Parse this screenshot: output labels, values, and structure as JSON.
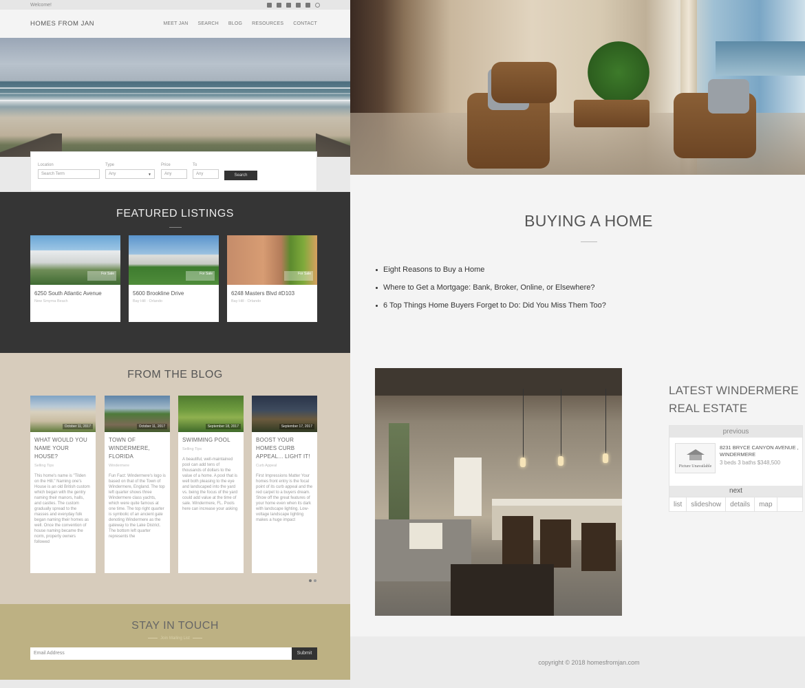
{
  "topbar": {
    "welcome": "Welcome!"
  },
  "nav": {
    "brand": "HOMES FROM JAN",
    "items": [
      "MEET JAN",
      "SEARCH",
      "BLOG",
      "RESOURCES",
      "CONTACT"
    ]
  },
  "search": {
    "location_label": "Location",
    "location_placeholder": "Search Term",
    "type_label": "Type",
    "type_value": "Any",
    "price_label": "Price",
    "price_value": "Any",
    "to_label": "To",
    "to_value": "Any",
    "button": "Search"
  },
  "featured": {
    "title": "FEATURED LISTINGS",
    "listings": [
      {
        "address": "6250 South Atlantic Avenue",
        "city": "New Smyrna Beach",
        "tag": "For Sale"
      },
      {
        "address": "5600 Brookline Drive",
        "city": "Bay Hill  ·  Orlando",
        "tag": "For Sale"
      },
      {
        "address": "6248 Masters Blvd #D103",
        "city": "Bay Hill  ·  Orlando",
        "tag": "For Sale"
      }
    ]
  },
  "blog": {
    "title": "FROM THE BLOG",
    "posts": [
      {
        "title": "WHAT WOULD YOU NAME YOUR HOUSE?",
        "category": "Selling Tips",
        "date": "October 11, 2017",
        "excerpt": "This home's name is \"Tilden on the Hill.\" Naming one's House is an old British custom which began with the gentry naming their manors, halls, and castles. The custom gradually spread to the masses and everyday folk began naming their homes as well. Once the convention of house naming became the norm, property owners followed"
      },
      {
        "title": "TOWN OF WINDERMERE, FLORIDA",
        "category": "Windermere",
        "date": "October 11, 2017",
        "excerpt": "Fun Fact: Windermere's logo is based on that of the Town of Windermere, England. The top left quarter shows three Windermere class yachts, which were quite famous at one time. The top right quarter is symbolic of an ancient gate denoting Windermere as the gateway to the Lake District. The bottom left quarter represents the"
      },
      {
        "title": "SWIMMING POOL",
        "category": "Selling Tips",
        "date": "September 18, 2017",
        "excerpt": "A beautiful, well-maintained pool can add tens of thousands of dollars to the value of a home. A pool that is well both pleasing to the eye and landscaped into the yard vs. being the focus of the yard could add value at the time of sale. Windermere, FL. Pools here can increase your asking"
      },
      {
        "title": "BOOST YOUR HOMES CURB APPEAL... LIGHT IT!",
        "category": "Curb Appeal",
        "date": "September 17, 2017",
        "excerpt": "First Impressions Matter Your homes front entry is the focal point of its curb appeal and the red carpet to a buyers dream. Show off the great features of your home even when its dark with landscape lighting. Low-voltage landscape lighting makes a huge impact"
      }
    ]
  },
  "touch": {
    "title": "STAY IN TOUCH",
    "subtitle": "Join Mailing List",
    "email_placeholder": "Email Address",
    "submit": "Submit"
  },
  "buying": {
    "title": "BUYING A HOME",
    "links": [
      "Eight Reasons to Buy a Home",
      "Where to Get a Mortgage: Bank, Broker, Online, or Elsewhere?",
      "6 Top Things Home Buyers Forget to Do: Did You Miss Them Too?"
    ]
  },
  "latest": {
    "title_line1": "LATEST WINDERMERE",
    "title_line2": "REAL ESTATE",
    "previous": "previous",
    "thumb_text": "Picture Unavailable",
    "address": "8231 BRYCE CANYON AVENUE , WINDERMERE",
    "meta": "3 beds 3 baths $348,500",
    "next": "next",
    "tabs": [
      "list",
      "slideshow",
      "details",
      "map"
    ]
  },
  "footer": {
    "copyright": "copyright © 2018 homesfromjan.com"
  }
}
